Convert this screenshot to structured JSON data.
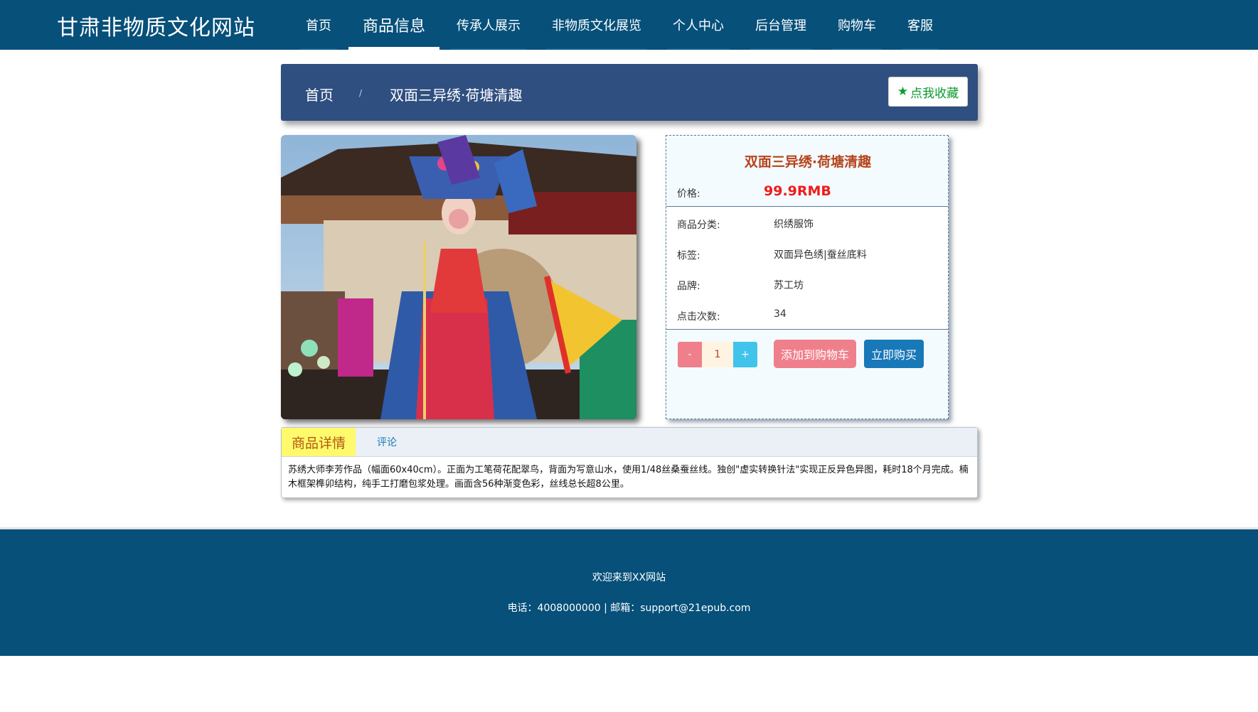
{
  "header": {
    "site_title": "甘肃非物质文化网站",
    "nav": [
      {
        "label": "首页"
      },
      {
        "label": "商品信息",
        "active": true
      },
      {
        "label": "传承人展示"
      },
      {
        "label": "非物质文化展览"
      },
      {
        "label": "个人中心"
      },
      {
        "label": "后台管理"
      },
      {
        "label": "购物车"
      },
      {
        "label": "客服"
      }
    ]
  },
  "breadcrumb": {
    "home": "首页",
    "separator": "/",
    "current": "双面三异绣·荷塘清趣"
  },
  "favorite_button": {
    "icon": "star-icon",
    "label": "点我收藏"
  },
  "product": {
    "title": "双面三异绣·荷塘清趣",
    "fields": [
      {
        "label": "价格:",
        "value": "99.9RMB"
      },
      {
        "label": "商品分类:",
        "value": "织绣服饰"
      },
      {
        "label": "标签:",
        "value": "双面异色绣|蚕丝底料"
      },
      {
        "label": "品牌:",
        "value": "苏工坊"
      },
      {
        "label": "点击次数:",
        "value": "34"
      }
    ],
    "quantity": {
      "minus": "-",
      "value": "1",
      "plus": "+"
    },
    "add_to_cart": "添加到购物车",
    "buy_now": "立即购买"
  },
  "tabs": {
    "items": [
      {
        "label": "商品详情",
        "active": true
      },
      {
        "label": "评论"
      }
    ],
    "content": "苏绣大师李芳作品（幅面60x40cm）。正面为工笔荷花配翠鸟，背面为写意山水，使用1/48丝桑蚕丝线。独创\"虚实转换针法\"实现正反异色异图，耗时18个月完成。楠木框架榫卯结构，纯手工打磨包浆处理。画面含56种渐变色彩，丝线总长超8公里。"
  },
  "footer": {
    "welcome": "欢迎来到XX网站",
    "contact": "电话：4008000000 | 邮箱：support@21epub.com"
  },
  "colors": {
    "header_bg": "#06507a",
    "breadcrumb_bg": "#2f4f80",
    "price": "#ee1c1c",
    "title": "#b5441c",
    "add_cart": "#f07f8c",
    "buy": "#1878b8"
  }
}
